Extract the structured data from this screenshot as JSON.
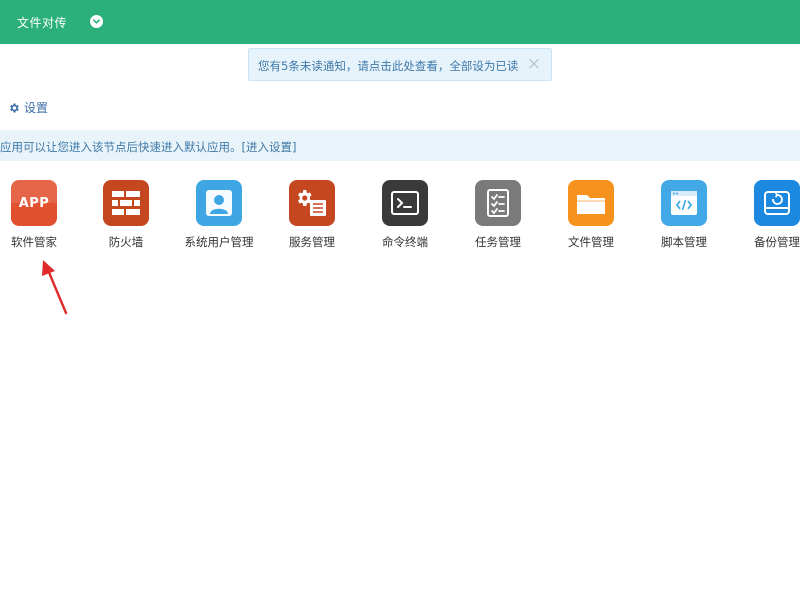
{
  "topbar": {
    "title": "文件对传",
    "toggle_icon": "chevron-down-icon",
    "color": "#2bb07b"
  },
  "notice": {
    "text": "您有5条未读通知，请点击此处查看，全部设为已读",
    "close": "×"
  },
  "settings": {
    "label": "设置",
    "icon": "gear-icon"
  },
  "info": {
    "text": "应用可以让您进入该节点后快速进入默认应用。[进入设置]"
  },
  "apps": [
    {
      "label": "软件管家",
      "icon": "app-icon",
      "icon_text": "APP",
      "color": "#e1502f"
    },
    {
      "label": "防火墙",
      "icon": "firewall-icon",
      "color": "#c4471f"
    },
    {
      "label": "系统用户管理",
      "icon": "user-icon",
      "color": "#3fa6e4"
    },
    {
      "label": "服务管理",
      "icon": "service-gear-icon",
      "color": "#c4471f"
    },
    {
      "label": "命令终端",
      "icon": "terminal-icon",
      "color": "#3a3a3a"
    },
    {
      "label": "任务管理",
      "icon": "checklist-icon",
      "color": "#7a7a7a"
    },
    {
      "label": "文件管理",
      "icon": "folder-icon",
      "color": "#f7921e"
    },
    {
      "label": "脚本管理",
      "icon": "script-icon",
      "color": "#43a9e6"
    },
    {
      "label": "备份管理",
      "icon": "backup-disk-icon",
      "color": "#1d88e0"
    }
  ],
  "annotation": {
    "arrow_icon": "red-arrow-icon",
    "color": "#e02a2a"
  }
}
